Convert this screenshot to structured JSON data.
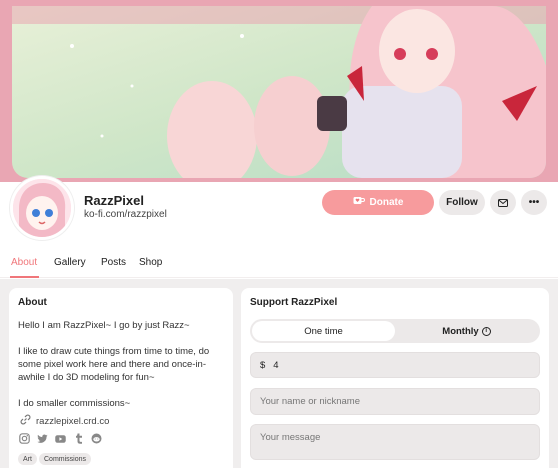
{
  "profile": {
    "name": "RazzPixel",
    "url": "ko-fi.com/razzpixel"
  },
  "actions": {
    "donate_label": "Donate",
    "follow_label": "Follow",
    "more_label": "•••",
    "donate_icon": "cup-heart-icon",
    "message_icon": "envelope-icon"
  },
  "tabs": [
    {
      "label": "About",
      "active": true
    },
    {
      "label": "Gallery",
      "active": false
    },
    {
      "label": "Posts",
      "active": false
    },
    {
      "label": "Shop",
      "active": false
    }
  ],
  "about": {
    "title": "About",
    "lines": [
      "Hello I am RazzPixel~ I go by just Razz~",
      "I like to draw cute things from time to time, do",
      "some pixel work here and there and once-in-",
      "awhile I do 3D modeling for fun~",
      "I do smaller commissions~"
    ],
    "link": "razzlepixel.crd.co",
    "socials": [
      "instagram-icon",
      "twitter-icon",
      "youtube-icon",
      "tumblr-icon",
      "reddit-icon"
    ],
    "tags": [
      "Art",
      "Commissions"
    ]
  },
  "support": {
    "title": "Support RazzPixel",
    "one_time_label": "One time",
    "monthly_label": "Monthly",
    "currency": "$",
    "amount": "4",
    "name_placeholder": "Your name or nickname",
    "message_placeholder": "Your message"
  },
  "colors": {
    "accent": "#f0767a",
    "donate_bg": "#f79b9d",
    "banner_border": "#e9a6b3"
  }
}
